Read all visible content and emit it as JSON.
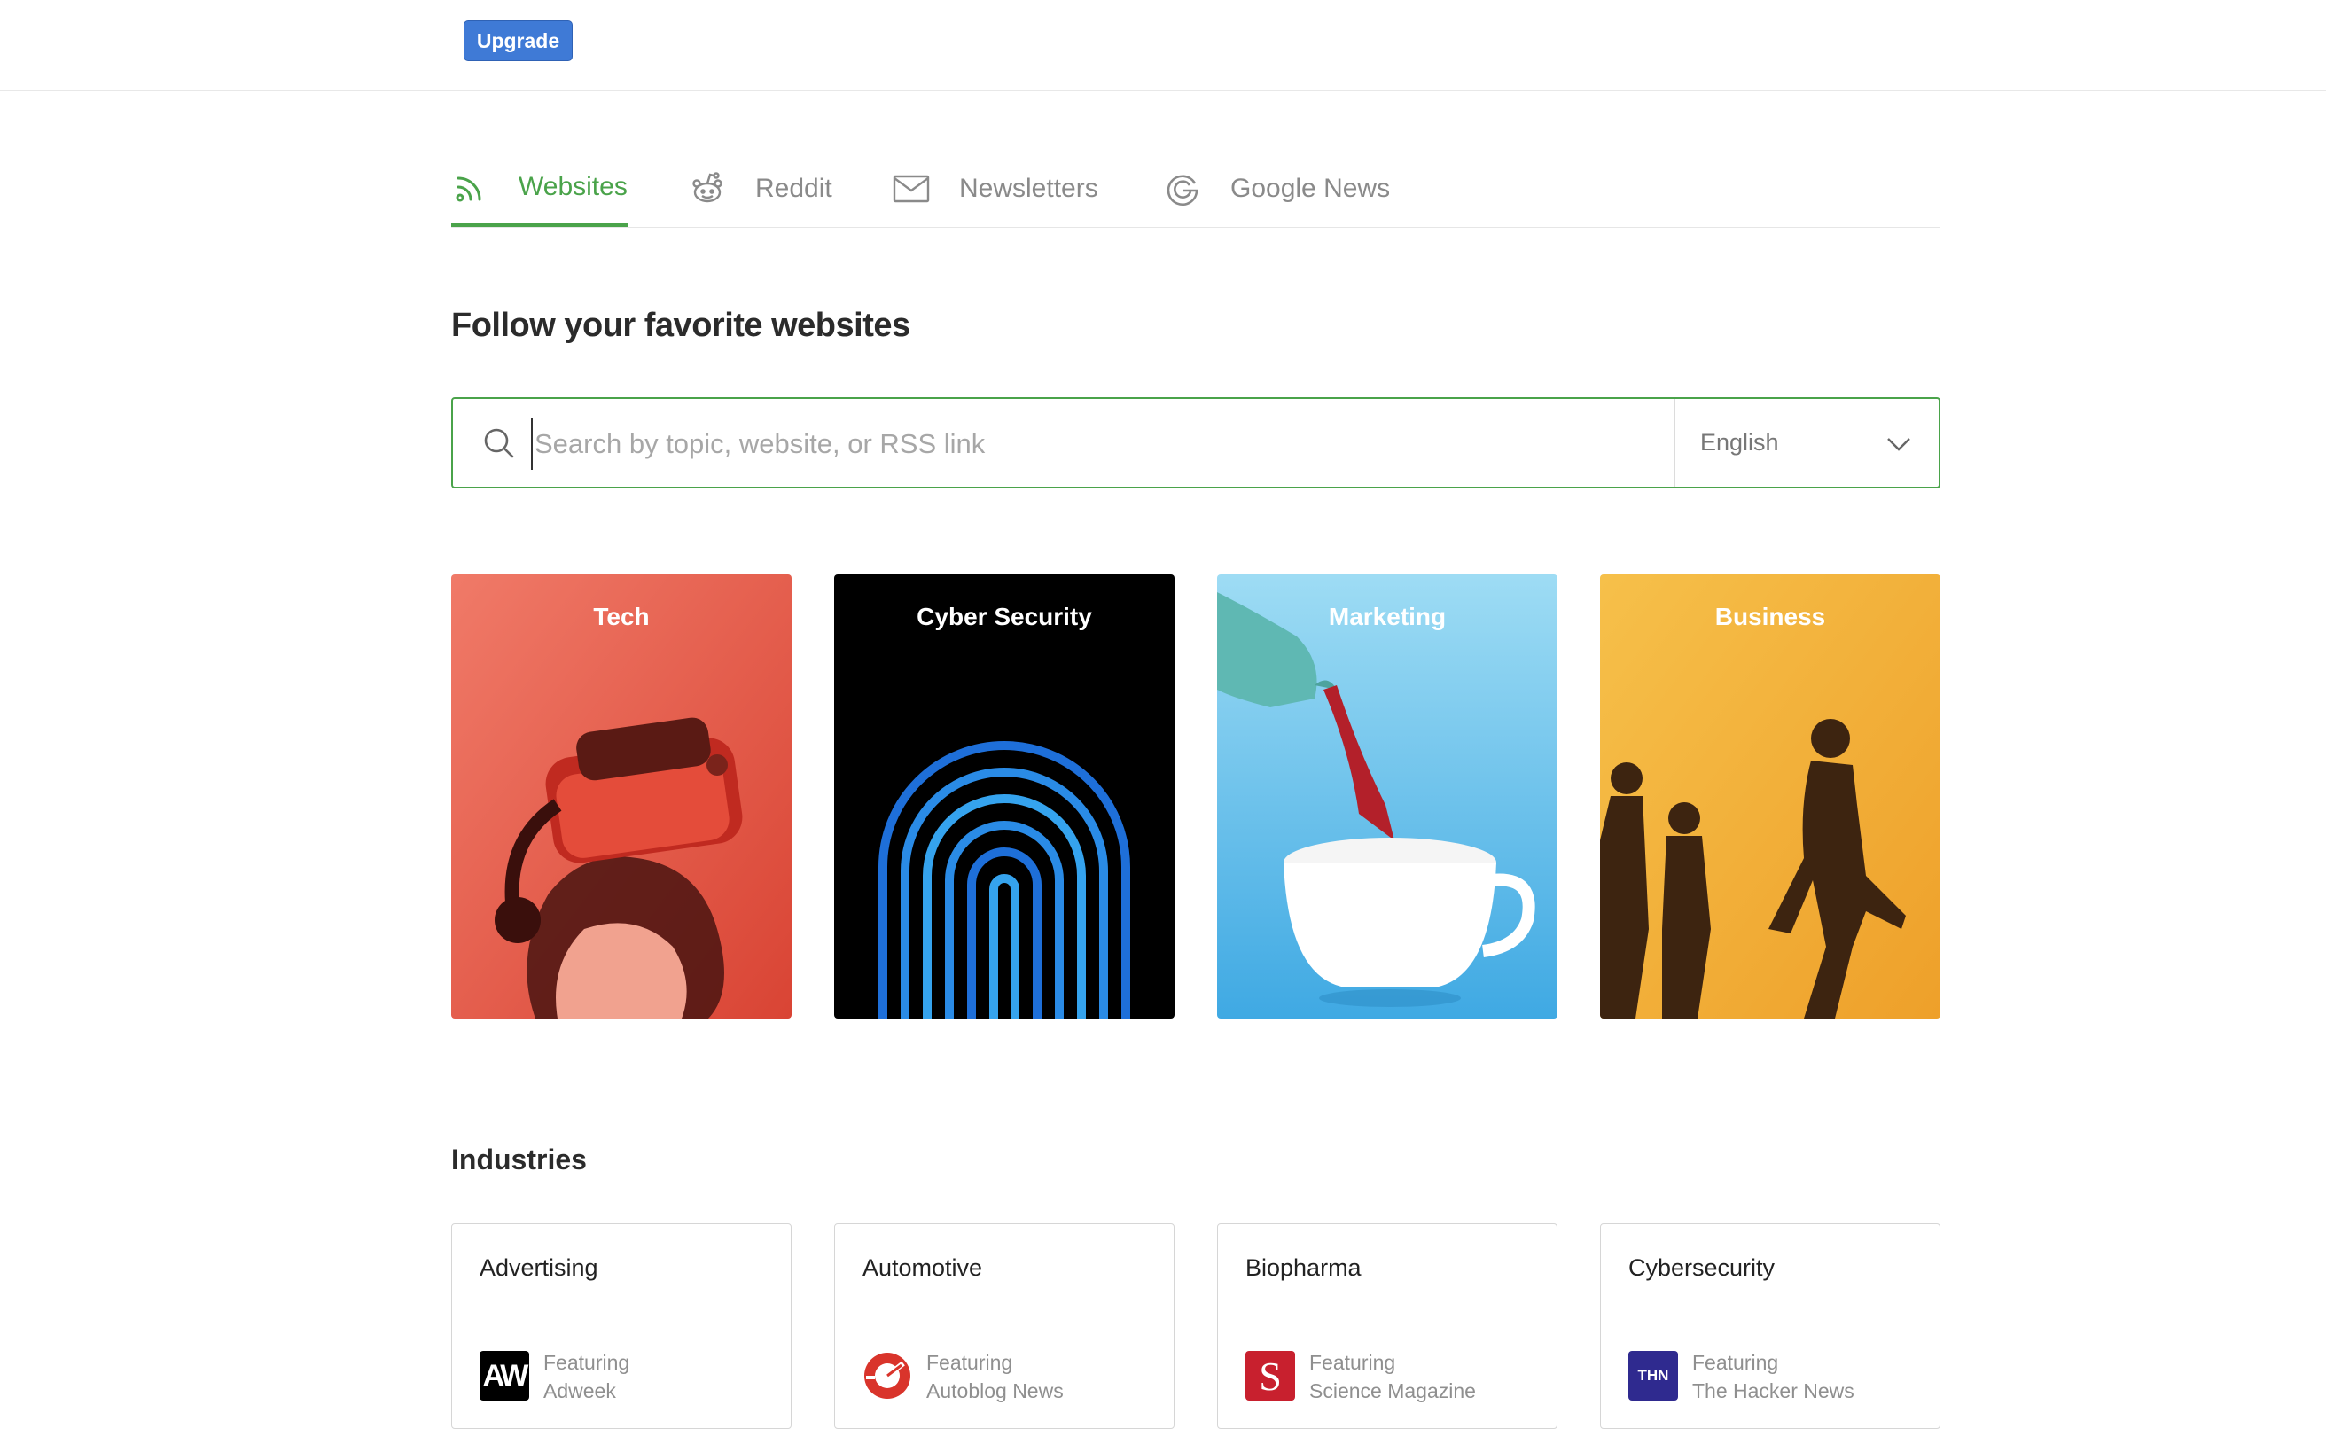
{
  "header": {
    "upgrade_label": "Upgrade"
  },
  "tabs": [
    {
      "label": "Websites",
      "icon": "rss-icon",
      "active": true
    },
    {
      "label": "Reddit",
      "icon": "reddit-icon",
      "active": false
    },
    {
      "label": "Newsletters",
      "icon": "envelope-icon",
      "active": false
    },
    {
      "label": "Google News",
      "icon": "google-icon",
      "active": false
    }
  ],
  "main": {
    "heading": "Follow your favorite websites",
    "search": {
      "placeholder": "Search by topic, website, or RSS link",
      "value": ""
    },
    "language": {
      "selected": "English"
    }
  },
  "topics": [
    {
      "label": "Tech",
      "color": "#e9604c"
    },
    {
      "label": "Cyber Security",
      "color": "#000000"
    },
    {
      "label": "Marketing",
      "color": "#6ec6ec"
    },
    {
      "label": "Business",
      "color": "#f2b23a"
    }
  ],
  "industries": {
    "title": "Industries",
    "items": [
      {
        "name": "Advertising",
        "featuring_label": "Featuring",
        "source": "Adweek",
        "logo_text": "AW"
      },
      {
        "name": "Automotive",
        "featuring_label": "Featuring",
        "source": "Autoblog News",
        "logo_text": ""
      },
      {
        "name": "Biopharma",
        "featuring_label": "Featuring",
        "source": "Science Magazine",
        "logo_text": "S"
      },
      {
        "name": "Cybersecurity",
        "featuring_label": "Featuring",
        "source": "The Hacker News",
        "logo_text": "THN"
      }
    ]
  },
  "colors": {
    "accent": "#4aa34a",
    "upgrade": "#3f7ad6"
  }
}
